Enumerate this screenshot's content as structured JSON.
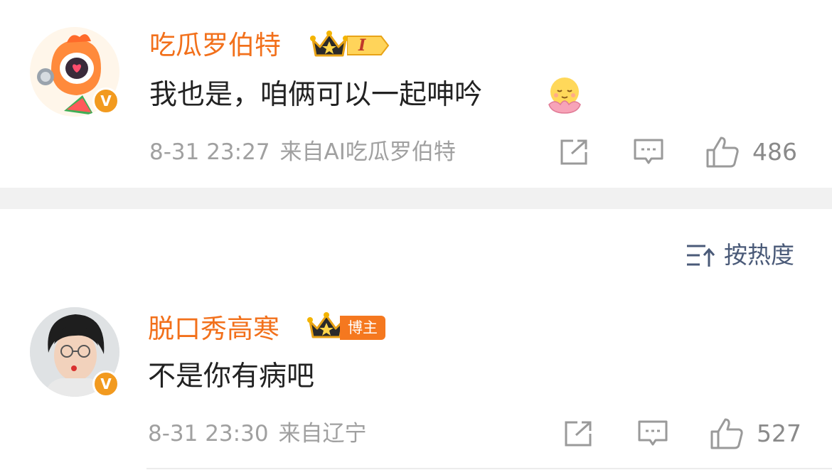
{
  "comments": [
    {
      "username": "吃瓜罗伯特",
      "level_badge": "I",
      "text": "我也是，咱俩可以一起呻吟",
      "emoji": "smiling-lotus-emoji",
      "time": "8-31 23:27",
      "source": "来自AI吃瓜罗伯特",
      "likes": "486",
      "verified": true
    },
    {
      "username": "脱口秀高寒",
      "badge": "博主",
      "text": "不是你有病吧",
      "time": "8-31 23:30",
      "source": "来自辽宁",
      "likes": "527",
      "verified": true
    }
  ],
  "verified_badge_letter": "V",
  "sort": {
    "label": "按热度",
    "icon": "sort-icon"
  },
  "colors": {
    "username": "#f2701b",
    "text": "#222222",
    "meta": "#a0a0a0",
    "verified": "#f29a1f",
    "sort": "#4a5a78"
  }
}
